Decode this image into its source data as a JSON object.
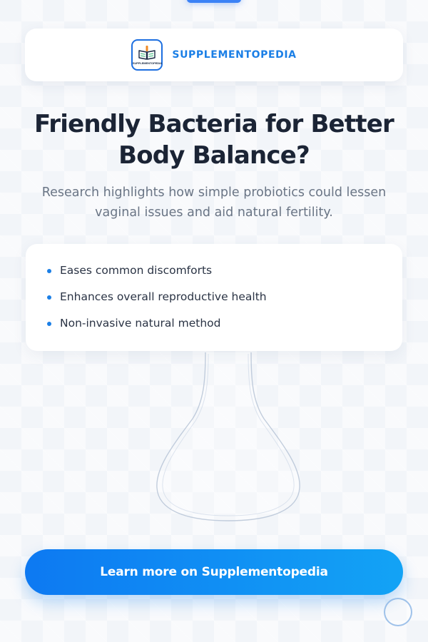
{
  "brand": {
    "name": "SUPPLEMENTOPEDIA",
    "logo_text": "SUPPLEMENTOPEDIA",
    "logo_icon": "open-book-icon",
    "accent_color": "#1b7fe6"
  },
  "headline": "Friendly Bacteria for Better Body Balance?",
  "subtitle": "Research highlights how simple probiotics could lessen vaginal issues and aid natural fertility.",
  "benefits": [
    "Eases common discomforts",
    "Enhances overall reproductive health",
    "Non-invasive natural method"
  ],
  "background_image": "glass-flask-outline",
  "cta": {
    "label": "Learn more on Supplementopedia",
    "gradient_start": "#0d79f2",
    "gradient_end": "#13a3f5"
  }
}
